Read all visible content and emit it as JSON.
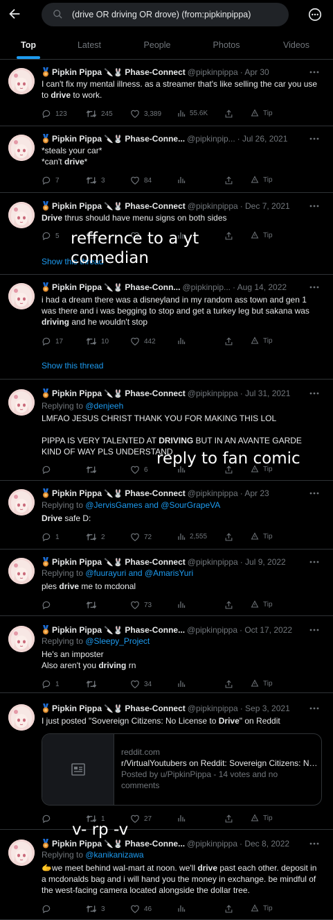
{
  "search": {
    "query": "(drive OR driving OR drove) (from:pipkinpippa)"
  },
  "tabs": [
    "Top",
    "Latest",
    "People",
    "Photos",
    "Videos"
  ],
  "tweets": [
    {
      "name": "Pipkin Pippa",
      "glyph": "🔪🐰",
      "org": "Phase-Connect",
      "handle": "@pipkinpippa",
      "date": "· Apr 30",
      "text": [
        "I can't fix my mental illness. as a streamer that's like selling the car you use to ",
        {
          "b": "drive"
        },
        " to work."
      ],
      "replies": "123",
      "retweets": "245",
      "likes": "3,389",
      "views": "55.6K",
      "tip": "Tip"
    },
    {
      "name": "Pipkin Pippa",
      "glyph": "🔪🐰",
      "org": "Phase-Conne...",
      "handle": "@pipkinpip...",
      "date": "· Jul 26, 2021",
      "text": [
        "*steals your car*\n*can't ",
        {
          "b": "drive"
        },
        "*"
      ],
      "replies": "7",
      "retweets": "3",
      "likes": "84",
      "views": "",
      "tip": "Tip"
    },
    {
      "name": "Pipkin Pippa",
      "glyph": "🔪🐰",
      "org": "Phase-Connect",
      "handle": "@pipkinpippa",
      "date": "· Dec 7, 2021",
      "text": [
        {
          "b": "Drive"
        },
        " thrus should have menu signs on both sides"
      ],
      "replies": "5",
      "retweets": "",
      "likes": "",
      "views": "",
      "tip": "Tip",
      "show": "Show this thread"
    },
    {
      "name": "Pipkin Pippa",
      "glyph": "🔪🐰",
      "org": "Phase-Conn...",
      "handle": "@pipkinpip...",
      "date": "· Aug 14, 2022",
      "text": [
        "i had a dream there was a disneyland in my random ass town and gen 1 was there and i was begging to stop and get a turkey leg but sakana was ",
        {
          "b": "driving"
        },
        " and he wouldn't stop"
      ],
      "replies": "17",
      "retweets": "10",
      "likes": "442",
      "views": "",
      "tip": "Tip",
      "show": "Show this thread"
    },
    {
      "name": "Pipkin Pippa",
      "glyph": "🔪🐰",
      "org": "Phase-Connect",
      "handle": "@pipkinpippa",
      "date": "· Jul 31, 2021",
      "replyto": "Replying to ",
      "mentions": "@denjeeh",
      "text": [
        "LMFAO JESUS CHRIST THANK YOU FOR MAKING THIS LOL\n\nPIPPA IS VERY TALENTED AT ",
        {
          "b": "DRIVING"
        },
        " BUT IN AN AVANTE GARDE KIND OF WAY PLS UNDERSTAND"
      ],
      "replies": "",
      "retweets": "",
      "likes": "6",
      "views": "",
      "tip": "Tip"
    },
    {
      "name": "Pipkin Pippa",
      "glyph": "🔪🐰",
      "org": "Phase-Connect",
      "handle": "@pipkinpippa",
      "date": "· Apr 23",
      "replyto": "Replying to ",
      "mentions": "@JervisGames and @SourGrapeVA",
      "text": [
        {
          "b": "Drive"
        },
        " safe D:"
      ],
      "replies": "1",
      "retweets": "2",
      "likes": "72",
      "views": "2,555",
      "tip": "Tip"
    },
    {
      "name": "Pipkin Pippa",
      "glyph": "🔪🐰",
      "org": "Phase-Connect",
      "handle": "@pipkinpippa",
      "date": "· Jul 9, 2022",
      "replyto": "Replying to ",
      "mentions": "@fuurayuri and @AmarisYuri",
      "text": [
        "ples ",
        {
          "b": "drive"
        },
        " me to mcdonal"
      ],
      "replies": "",
      "retweets": "",
      "likes": "73",
      "views": "",
      "tip": "Tip"
    },
    {
      "name": "Pipkin Pippa",
      "glyph": "🔪🐰",
      "org": "Phase-Conne...",
      "handle": "@pipkinpippa",
      "date": "· Oct 17, 2022",
      "replyto": "Replying to ",
      "mentions": "@Sleepy_Project",
      "text": [
        "He's an imposter\nAlso aren't you ",
        {
          "b": "driving"
        },
        " rn"
      ],
      "replies": "1",
      "retweets": "",
      "likes": "34",
      "views": "",
      "tip": "Tip"
    },
    {
      "name": "Pipkin Pippa",
      "glyph": "🔪🐰",
      "org": "Phase-Connect",
      "handle": "@pipkinpippa",
      "date": "· Sep 3, 2021",
      "text": [
        "I just posted \"Sovereign Citizens: No License to ",
        {
          "b": "Drive"
        },
        "\" on Reddit"
      ],
      "card": {
        "domain": "reddit.com",
        "title": "r/VirtualYoutubers on Reddit: Sovereign Citizens: No License to Drive",
        "desc": "Posted by u/PipkinPippa - 14 votes and no comments"
      },
      "replies": "",
      "retweets": "1",
      "likes": "27",
      "views": "",
      "tip": "Tip"
    },
    {
      "name": "Pipkin Pippa",
      "glyph": "🔪🐰",
      "org": "Phase-Conne...",
      "handle": "@pipkinpippa",
      "date": "· Dec 8, 2022",
      "replyto": "Replying to ",
      "mentions": "@kanikanizawa",
      "text": [
        "🫱we meet behind wal-mart at noon. we'll ",
        {
          "b": "drive"
        },
        " past each other. deposit in a mcdonalds bag and i will hand you the money in exchange. be mindful of the west-facing camera located alongside the dollar tree."
      ],
      "replies": "",
      "retweets": "3",
      "likes": "46",
      "views": "",
      "tip": "Tip"
    }
  ],
  "overlays": {
    "o1": "reffernce to a yt\ncomedian",
    "o2": "reply to fan comic",
    "o3": "v- rp -v"
  }
}
